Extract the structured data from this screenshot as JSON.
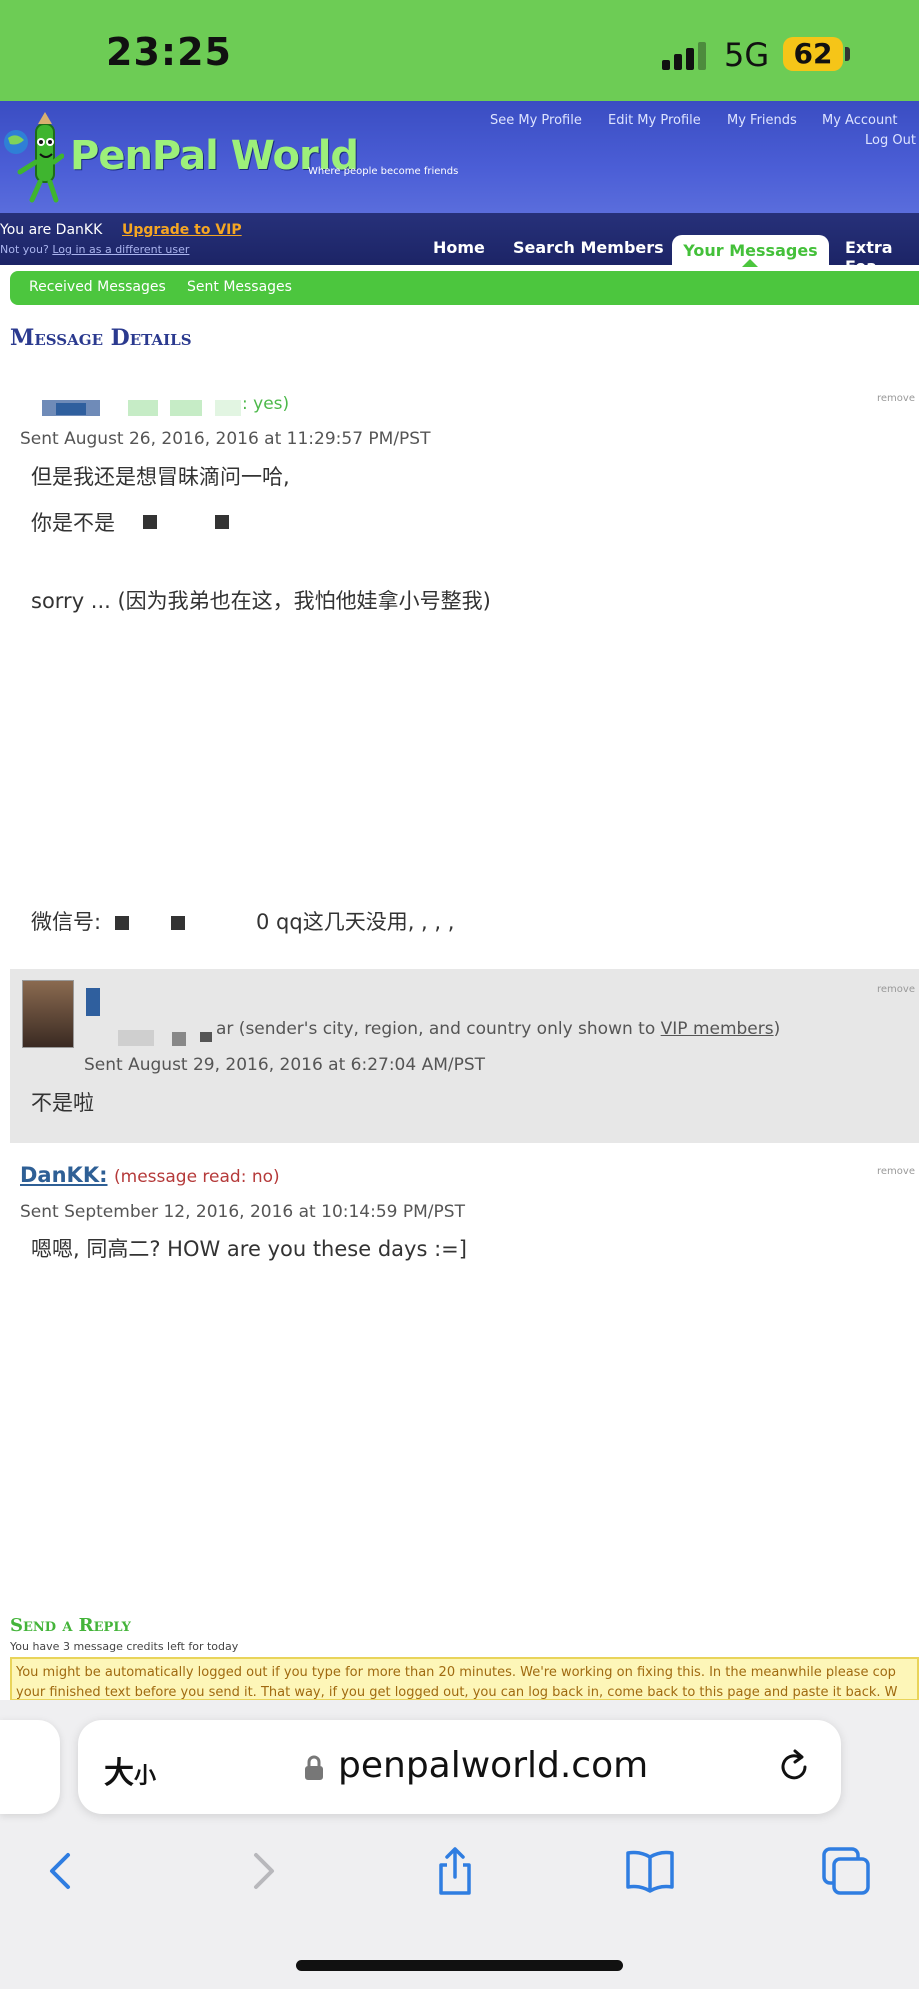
{
  "status_bar": {
    "time": "23:25",
    "network": "5G",
    "battery": "62"
  },
  "site": {
    "logo_text": "PenPal World",
    "tagline": "Where people become friends",
    "top_links": {
      "see_profile": "See My Profile",
      "edit_profile": "Edit My Profile",
      "friends": "My Friends",
      "account": "My Account",
      "logout": "Log Out"
    },
    "user": {
      "you_are": "You are DanKK",
      "upgrade": "Upgrade to VIP",
      "not_you": "Not you?",
      "login_different": "Log in as a different user"
    },
    "tabs": {
      "home": "Home",
      "search": "Search Members",
      "messages": "Your Messages",
      "extra": "Extra Fea"
    },
    "subnav": {
      "received": "Received Messages",
      "sent": "Sent Messages"
    }
  },
  "page_title": "Message Details",
  "messages": [
    {
      "read_status": ": yes)",
      "sent": "Sent August 26, 2016, 2016 at 11:29:57 PM/PST",
      "line1": "但是我还是想冒昧滴问一哈,",
      "line2": "你是不是",
      "line3": "sorry ... (因为我弟也在这，我怕他娃拿小号整我)",
      "line4_prefix": "微信号:",
      "line4_suffix": "0 qq这几天没用, , , ,",
      "remove": "remove"
    },
    {
      "location": "ar (sender's city, region, and country only shown to ",
      "vip_link": "VIP members",
      "location_end": ")",
      "sent": "Sent August 29, 2016, 2016 at 6:27:04 AM/PST",
      "text": "不是啦",
      "remove": "remove"
    },
    {
      "sender": "DanKK:",
      "read_status": "(message read: no)",
      "sent": "Sent September 12, 2016, 2016 at 10:14:59 PM/PST",
      "text": "嗯嗯, 同高二? HOW are you these days :=]",
      "remove": "remove"
    }
  ],
  "reply": {
    "title": "Send a Reply",
    "credits": "You have 3 message credits left for today",
    "warning_line1": "You might be automatically logged out if you type for more than 20 minutes. We're working on fixing this. In the meanwhile please cop",
    "warning_line2": "your finished text before you send it. That way, if you get logged out, you can log back in, come back to this page and paste it back. W"
  },
  "browser": {
    "size_label": "大",
    "size_small": "小",
    "url": "penpalworld.com"
  },
  "colors": {
    "status_green": "#6dcc55",
    "header_blue": "#4b5ed6",
    "nav_green": "#4cc63e",
    "title_navy": "#2b3a8f"
  }
}
